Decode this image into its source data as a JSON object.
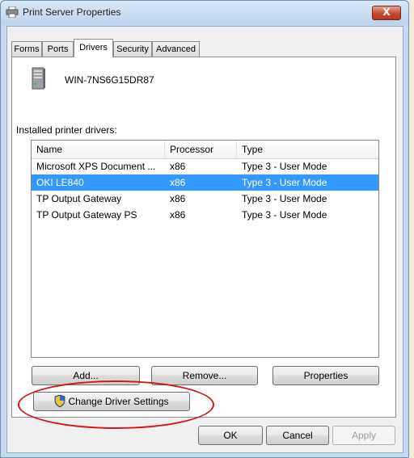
{
  "window": {
    "title": "Print Server Properties",
    "close_label": "X"
  },
  "tabs": [
    {
      "label": "Forms"
    },
    {
      "label": "Ports"
    },
    {
      "label": "Drivers",
      "active": true
    },
    {
      "label": "Security"
    },
    {
      "label": "Advanced"
    }
  ],
  "server": {
    "name": "WIN-7NS6G15DR87"
  },
  "drivers": {
    "label": "Installed printer drivers:",
    "columns": [
      "Name",
      "Processor",
      "Type"
    ],
    "rows": [
      {
        "name": "Microsoft XPS Document ...",
        "processor": "x86",
        "type": "Type 3 - User Mode"
      },
      {
        "name": "OKI LE840",
        "processor": "x86",
        "type": "Type 3 - User Mode",
        "selected": true
      },
      {
        "name": "TP Output Gateway",
        "processor": "x86",
        "type": "Type 3 - User Mode"
      },
      {
        "name": "TP Output Gateway PS",
        "processor": "x86",
        "type": "Type 3 - User Mode"
      }
    ],
    "selection_color": "#3399ff"
  },
  "buttons": {
    "add": "Add...",
    "remove": "Remove...",
    "properties": "Properties",
    "change_driver": "Change Driver Settings",
    "ok": "OK",
    "cancel": "Cancel",
    "apply": "Apply"
  },
  "annotation": {
    "color": "#d8141b",
    "shape": "ellipse around Change Driver Settings"
  }
}
